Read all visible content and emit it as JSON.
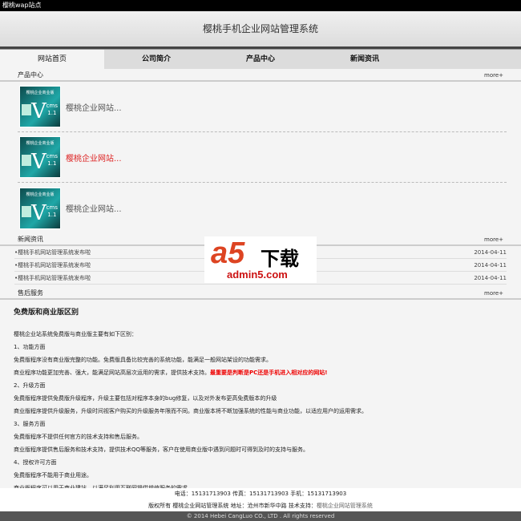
{
  "topbar": {
    "title": "樱桃wap站点"
  },
  "header": {
    "title": "樱桃手机企业网站管理系统"
  },
  "nav": [
    "网站首页",
    "公司简介",
    "产品中心",
    "新闻资讯"
  ],
  "sections": {
    "products": "产品中心",
    "news": "新闻资讯",
    "service": "售后服务",
    "more": "more+"
  },
  "products": [
    {
      "title": "樱桃企业网站...",
      "thumb_top": "樱桃企业商业版",
      "thumb_v": "V",
      "thumb_cms": "cms",
      "thumb_ver": "1.1"
    },
    {
      "title": "樱桃企业网站...",
      "thumb_top": "樱桃企业商业版",
      "thumb_v": "V",
      "thumb_cms": "cms",
      "thumb_ver": "1.1"
    },
    {
      "title": "樱桃企业网站...",
      "thumb_top": "樱桃企业商业版",
      "thumb_v": "V",
      "thumb_cms": "cms",
      "thumb_ver": "1.1"
    }
  ],
  "news": [
    {
      "title": "•樱桃手机网站管理系统发布啦",
      "date": "2014-04-11"
    },
    {
      "title": "•樱桃手机网站管理系统发布啦",
      "date": "2014-04-11"
    },
    {
      "title": "•樱桃手机网站管理系统发布啦",
      "date": "2014-04-11"
    }
  ],
  "content": {
    "title": "免费版和商业版区别",
    "intro": "樱桃企业站系统免费版与商业版主要有如下区别：",
    "l1": "1、功能方面",
    "l2": "免费版程序没有商业版完整的功能。免费版具备比较完善的系统功能，能满足一般网站架设的功能需求。",
    "l3": "商业程序功能更加完善、强大，能满足网站高层次运用的需求，提供技术支持。",
    "l3_red": "最重要是判断是PC还是手机进入相对应的网站!",
    "l4": "2、升级方面",
    "l5": "免费版程序提供免费版升级程序，升级主要包括对程序本身的bug修复，以及对外发布更高免费版本的升级",
    "l6": "商业版程序提供升级服务，升级时间视客户购买的升级服务年限而不同。商业版本将不断加强系统的性能与商业功能，以适应用户的运用需求。",
    "l7": "3、服务方面",
    "l8": "免费版程序不提供任何官方的技术支持和售后服务。",
    "l9": "商业版程序提供售后服务和技术支持，提供技术QQ等服务，客户在使用商业版中遇到问题时可得到及时的支持与服务。",
    "l10": "4、授权许可方面",
    "l11": "免费版程序不能用于商业用途。",
    "l12": "商业版程序可以用于商业建站，以满足利用互联网提供增值服务的需求。"
  },
  "footer": {
    "contact": "电话：15131713903 传真：15131713903 手机：15131713903",
    "copyright_prefix": "版权所有 樱桃企业网站管理系统 地址：沧州市新华中路 技术支持：",
    "support_link": "樱桃企业网站管理系统",
    "copy": "© 2014 Hebei CangLuo CO., LTD . All rights reserved"
  },
  "watermark": {
    "logo": "a5",
    "text": "下载",
    "domain": "admin5.com"
  }
}
